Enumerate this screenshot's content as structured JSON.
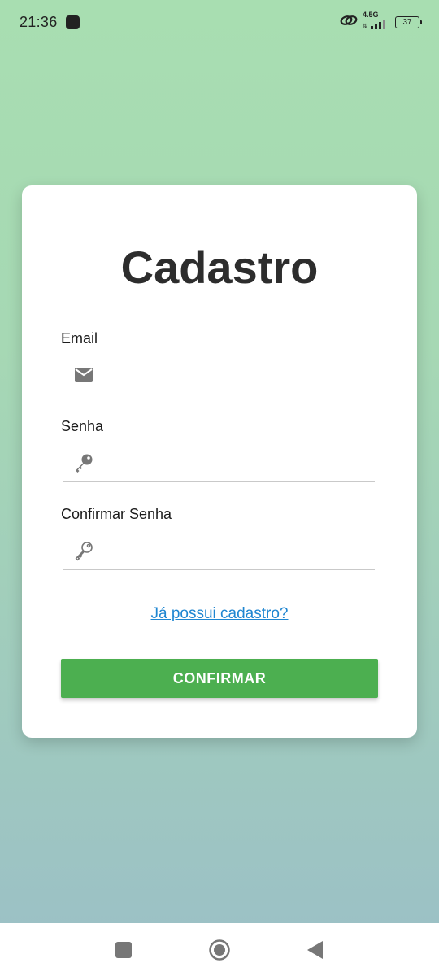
{
  "status_bar": {
    "time": "21:36",
    "network": "4.5G",
    "battery": "37"
  },
  "form": {
    "title": "Cadastro",
    "fields": [
      {
        "label": "Email",
        "value": "",
        "icon": "mail-icon"
      },
      {
        "label": "Senha",
        "value": "",
        "icon": "key-filled-icon"
      },
      {
        "label": "Confirmar Senha",
        "value": "",
        "icon": "key-outline-icon"
      }
    ],
    "login_link": "Já possui cadastro?",
    "confirm_label": "CONFIRMAR"
  },
  "colors": {
    "accent": "#4caf50",
    "link": "#1f86d1",
    "background_top": "#a8deb1",
    "background_bottom": "#9bbfc7"
  },
  "nav_bar": {
    "buttons": [
      "recents-icon",
      "home-icon",
      "back-icon"
    ]
  }
}
